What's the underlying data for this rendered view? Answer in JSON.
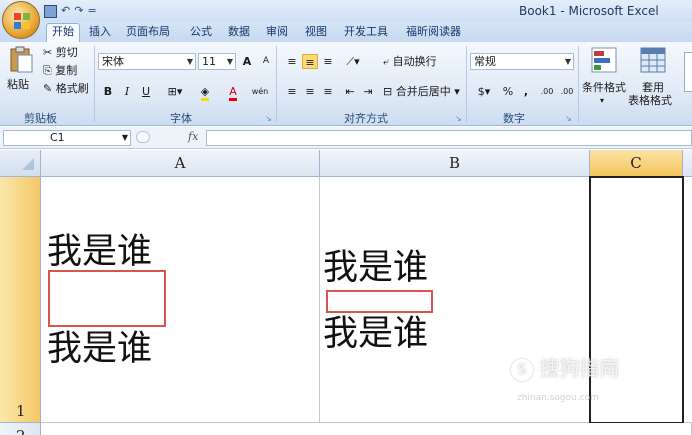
{
  "window": {
    "title": "Book1 - Microsoft Excel"
  },
  "quick_access": {
    "undo_label": "↶",
    "redo_label": "↷",
    "customize_label": "="
  },
  "tabs": [
    {
      "label": "开始",
      "active": true
    },
    {
      "label": "插入"
    },
    {
      "label": "页面布局"
    },
    {
      "label": "公式"
    },
    {
      "label": "数据"
    },
    {
      "label": "审阅"
    },
    {
      "label": "视图"
    },
    {
      "label": "开发工具"
    },
    {
      "label": "福昕阅读器"
    }
  ],
  "ribbon": {
    "clipboard": {
      "label": "剪贴板",
      "paste": "粘贴",
      "cut": "剪切",
      "copy": "复制",
      "format_painter": "格式刷"
    },
    "font": {
      "label": "字体",
      "font_name": "宋体",
      "font_size": "11",
      "grow": "A",
      "shrink": "A",
      "bold": "B",
      "italic": "I",
      "underline": "U",
      "font_color_glyph": "A",
      "phonetic": "wén"
    },
    "alignment": {
      "label": "对齐方式",
      "wrap_text": "自动换行",
      "merge_center": "合并后居中"
    },
    "number": {
      "label": "数字",
      "format": "常规",
      "percent": "%",
      "comma": ",",
      "inc_decimal": ".00",
      "dec_decimal": ".00"
    },
    "styles": {
      "conditional_format": "条件格式",
      "format_as_table_1": "套用",
      "format_as_table_2": "表格格式"
    }
  },
  "formula_bar": {
    "name_box": "C1",
    "fx": "fx",
    "content": ""
  },
  "columns": [
    "A",
    "B",
    "C"
  ],
  "rows": [
    "1",
    "2"
  ],
  "cells": {
    "A1": {
      "line1": "我是谁",
      "line2": "我是谁"
    },
    "B1": {
      "line1": "我是谁",
      "line2": "我是谁"
    }
  },
  "watermark": {
    "text": "搜狗指南",
    "sub": "zhinan.sogou.com"
  },
  "colors": {
    "selected_header": "#f5c55b",
    "red_box": "#d9534f"
  }
}
